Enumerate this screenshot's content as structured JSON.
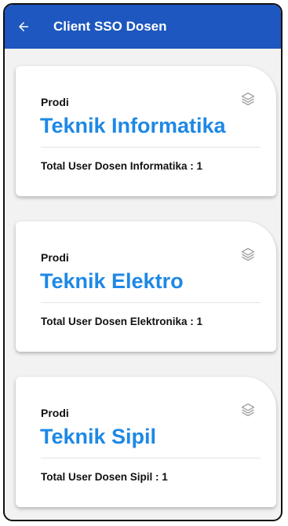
{
  "header": {
    "title": "Client SSO Dosen"
  },
  "icons": {
    "back": "arrow-left-icon",
    "card": "layers-icon"
  },
  "colors": {
    "appbar": "#1d57bf",
    "prodi_name": "#1e88e5",
    "background": "#f2f2f2"
  },
  "cards": [
    {
      "label": "Prodi",
      "name": "Teknik Informatika",
      "total": "Total User Dosen Informatika : 1"
    },
    {
      "label": "Prodi",
      "name": "Teknik Elektro",
      "total": "Total User Dosen Elektronika : 1"
    },
    {
      "label": "Prodi",
      "name": "Teknik Sipil",
      "total": "Total User Dosen Sipil : 1"
    }
  ]
}
